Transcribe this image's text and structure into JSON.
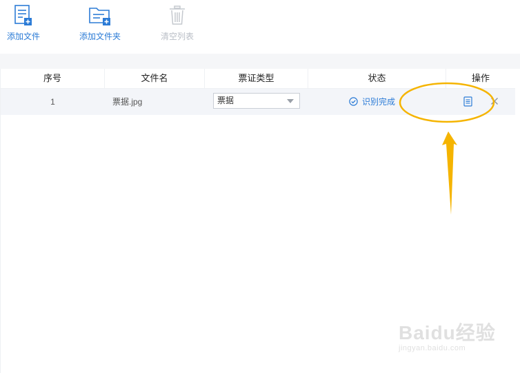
{
  "toolbar": {
    "add_file": "添加文件",
    "add_folder": "添加文件夹",
    "clear_list": "清空列表"
  },
  "table": {
    "headers": [
      "序号",
      "文件名",
      "票证类型",
      "状态",
      "操作"
    ],
    "rows": [
      {
        "index": "1",
        "filename": "票据.jpg",
        "ticket_type": "票据",
        "status": "识别完成"
      }
    ]
  },
  "colors": {
    "accent": "#2b7bd6",
    "annotation": "#f5b400",
    "row_bg": "#f3f5f9"
  },
  "watermark": {
    "brand": "Baidu经验",
    "url": "jingyan.baidu.com"
  }
}
